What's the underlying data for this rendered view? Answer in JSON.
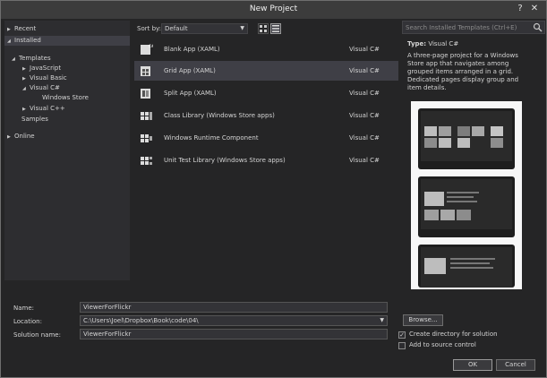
{
  "window": {
    "title": "New Project",
    "help": "?",
    "close": "✕"
  },
  "left_tree": {
    "recent": "Recent",
    "installed": "Installed",
    "templates": "Templates",
    "javascript": "JavaScript",
    "visual_basic": "Visual Basic",
    "visual_csharp": "Visual C#",
    "windows_store": "Windows Store",
    "visual_cpp": "Visual C++",
    "samples": "Samples",
    "online": "Online"
  },
  "toolbar": {
    "sort_label": "Sort by:",
    "sort_value": "Default"
  },
  "search": {
    "placeholder": "Search Installed Templates (Ctrl+E)"
  },
  "templates": [
    {
      "name": "Blank App (XAML)",
      "lang": "Visual C#"
    },
    {
      "name": "Grid App (XAML)",
      "lang": "Visual C#"
    },
    {
      "name": "Split App (XAML)",
      "lang": "Visual C#"
    },
    {
      "name": "Class Library (Windows Store apps)",
      "lang": "Visual C#"
    },
    {
      "name": "Windows Runtime Component",
      "lang": "Visual C#"
    },
    {
      "name": "Unit Test Library (Windows Store apps)",
      "lang": "Visual C#"
    }
  ],
  "details": {
    "type_label": "Type:",
    "type_value": "Visual C#",
    "description": "A three-page project for a Windows Store app that navigates among grouped items arranged in a grid. Dedicated pages display group and item details."
  },
  "form": {
    "name_label": "Name:",
    "name_value": "ViewerForFlickr",
    "location_label": "Location:",
    "location_value": "C:\\Users\\Joel\\Dropbox\\Book\\code\\04\\",
    "solution_label": "Solution name:",
    "solution_value": "ViewerForFlickr",
    "browse": "Browse...",
    "create_dir": "Create directory for solution",
    "add_source": "Add to source control",
    "ok": "OK",
    "cancel": "Cancel"
  }
}
